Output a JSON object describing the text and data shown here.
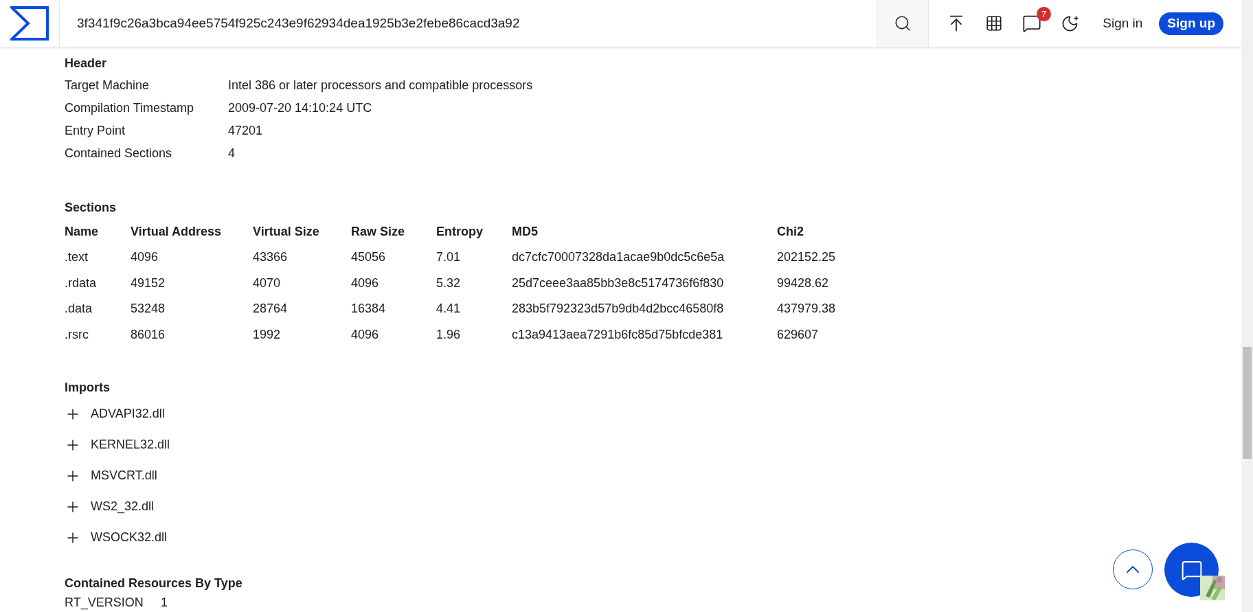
{
  "topbar": {
    "search_value": "3f341f9c26a3bca94ee5754f925c243e9f62934dea1925b3e2febe86cacd3a92",
    "notifications": "7",
    "sign_in": "Sign in",
    "sign_up": "Sign up"
  },
  "header": {
    "title": "Header",
    "rows": [
      {
        "label": "Target Machine",
        "value": "Intel 386 or later processors and compatible processors"
      },
      {
        "label": "Compilation Timestamp",
        "value": "2009-07-20 14:10:24 UTC"
      },
      {
        "label": "Entry Point",
        "value": "47201"
      },
      {
        "label": "Contained Sections",
        "value": "4"
      }
    ]
  },
  "sections": {
    "title": "Sections",
    "columns": [
      "Name",
      "Virtual Address",
      "Virtual Size",
      "Raw Size",
      "Entropy",
      "MD5",
      "Chi2"
    ],
    "rows": [
      [
        ".text",
        "4096",
        "43366",
        "45056",
        "7.01",
        "dc7cfc70007328da1acae9b0dc5c6e5a",
        "202152.25"
      ],
      [
        ".rdata",
        "49152",
        "4070",
        "4096",
        "5.32",
        "25d7ceee3aa85bb3e8c5174736f6f830",
        "99428.62"
      ],
      [
        ".data",
        "53248",
        "28764",
        "16384",
        "4.41",
        "283b5f792323d57b9db4d2bcc46580f8",
        "437979.38"
      ],
      [
        ".rsrc",
        "86016",
        "1992",
        "4096",
        "1.96",
        "c13a9413aea7291b6fc85d75bfcde381",
        "629607"
      ]
    ]
  },
  "imports": {
    "title": "Imports",
    "items": [
      {
        "name": "ADVAPI32.dll",
        "expanded": false
      },
      {
        "name": "KERNEL32.dll",
        "expanded": false
      },
      {
        "name": "MSVCRT.dll",
        "expanded": false
      },
      {
        "name": "WS2_32.dll",
        "expanded": false
      },
      {
        "name": "WSOCK32.dll",
        "expanded": false
      }
    ]
  },
  "resources": {
    "title": "Contained Resources By Type",
    "rows": [
      {
        "label": "RT_VERSION",
        "value": "1"
      }
    ]
  }
}
